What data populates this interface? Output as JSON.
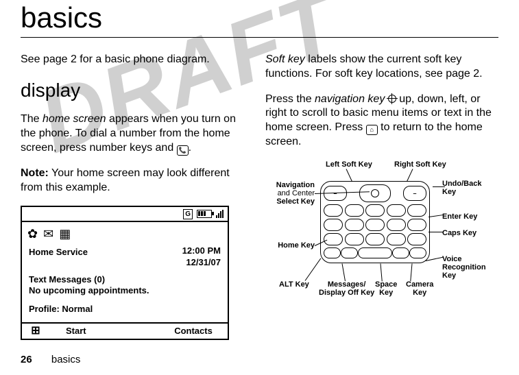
{
  "watermark": "DRAFT",
  "title": "basics",
  "footer": {
    "page": "26",
    "section": "basics"
  },
  "col1": {
    "p1": "See page 2 for a basic phone diagram.",
    "h2": "display",
    "p2a": "The ",
    "p2b": "home screen",
    "p2c": " appears when you turn on the phone. To dial a number from the home screen, press number keys and ",
    "p2d": ".",
    "note_label": "Note:",
    "note_body": " Your home screen may look different from this example."
  },
  "phone": {
    "g_badge": "G",
    "service": "Home Service",
    "time": "12:00 PM",
    "date": "12/31/07",
    "msgs": "Text Messages (0)",
    "appt": "No upcoming appointments.",
    "profile": "Profile: Normal",
    "soft_left": "Start",
    "soft_right": "Contacts"
  },
  "col2": {
    "p1a": "Soft key",
    "p1b": " labels show the current soft key functions. For soft key locations, see page 2.",
    "p2a": "Press the ",
    "p2b": "navigation key",
    "p2c": " up, down, left, or right to scroll to basic menu items or text in the home screen. Press ",
    "p2d": " to return to the home screen."
  },
  "diagram": {
    "left_soft": "Left Soft Key",
    "right_soft": "Right Soft Key",
    "nav_center": "Navigation",
    "nav_center2": "and Center",
    "nav_center3": "Select Key",
    "undo": "Undo/Back",
    "undo2": "Key",
    "enter": "Enter Key",
    "caps": "Caps Key",
    "home": "Home Key",
    "voice": "Voice",
    "voice2": "Recognition",
    "voice3": "Key",
    "alt": "ALT Key",
    "msgoff": "Messages/",
    "msgoff2": "Display Off Key",
    "space": "Space",
    "space2": "Key",
    "camera": "Camera",
    "camera2": "Key"
  },
  "icons": {
    "dial_key_glyph": "📞",
    "home_key_glyph": "⌂",
    "phone_status_gear": "✿",
    "phone_status_mail": "✉",
    "phone_status_cal": "▦",
    "windows_glyph": "⊞"
  }
}
